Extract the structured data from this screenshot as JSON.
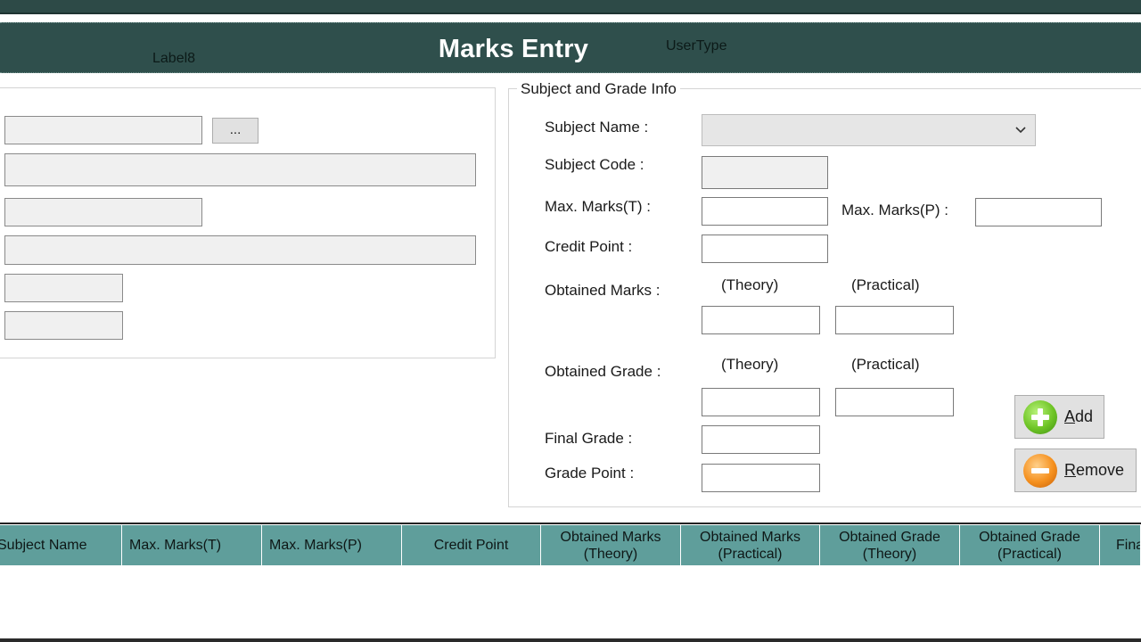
{
  "header": {
    "title": "Marks Entry",
    "label8": "Label8",
    "user_type": "UserType"
  },
  "left_panel": {
    "browse_button": "..."
  },
  "subject_group": {
    "title": "Subject and Grade Info",
    "subject_name_label": "Subject Name :",
    "subject_name_value": "",
    "subject_code_label": "Subject Code :",
    "max_marks_t_label": "Max. Marks(T) :",
    "max_marks_p_label": "Max. Marks(P) :",
    "credit_point_label": "Credit Point :",
    "obtained_marks_label": "Obtained Marks :",
    "obtained_grade_label": "Obtained Grade :",
    "theory_label": "(Theory)",
    "practical_label": "(Practical)",
    "final_grade_label": "Final Grade :",
    "grade_point_label": "Grade Point :"
  },
  "buttons": {
    "add_label_u": "A",
    "add_label_rest": "dd",
    "remove_label_u": "R",
    "remove_label_rest": "emove"
  },
  "grid": {
    "columns": [
      "Subject Name",
      "Max. Marks(T)",
      "Max. Marks(P)",
      "Credit Point",
      "Obtained Marks\n(Theory)",
      "Obtained Marks\n(Practical)",
      "Obtained Grade\n(Theory)",
      "Obtained Grade\n(Practical)",
      "Fina"
    ],
    "rows": []
  },
  "colors": {
    "header_bg": "#2f4f4c",
    "grid_header_bg": "#5f9e9b",
    "add_icon": "#6ec425",
    "remove_icon": "#f5901e"
  }
}
